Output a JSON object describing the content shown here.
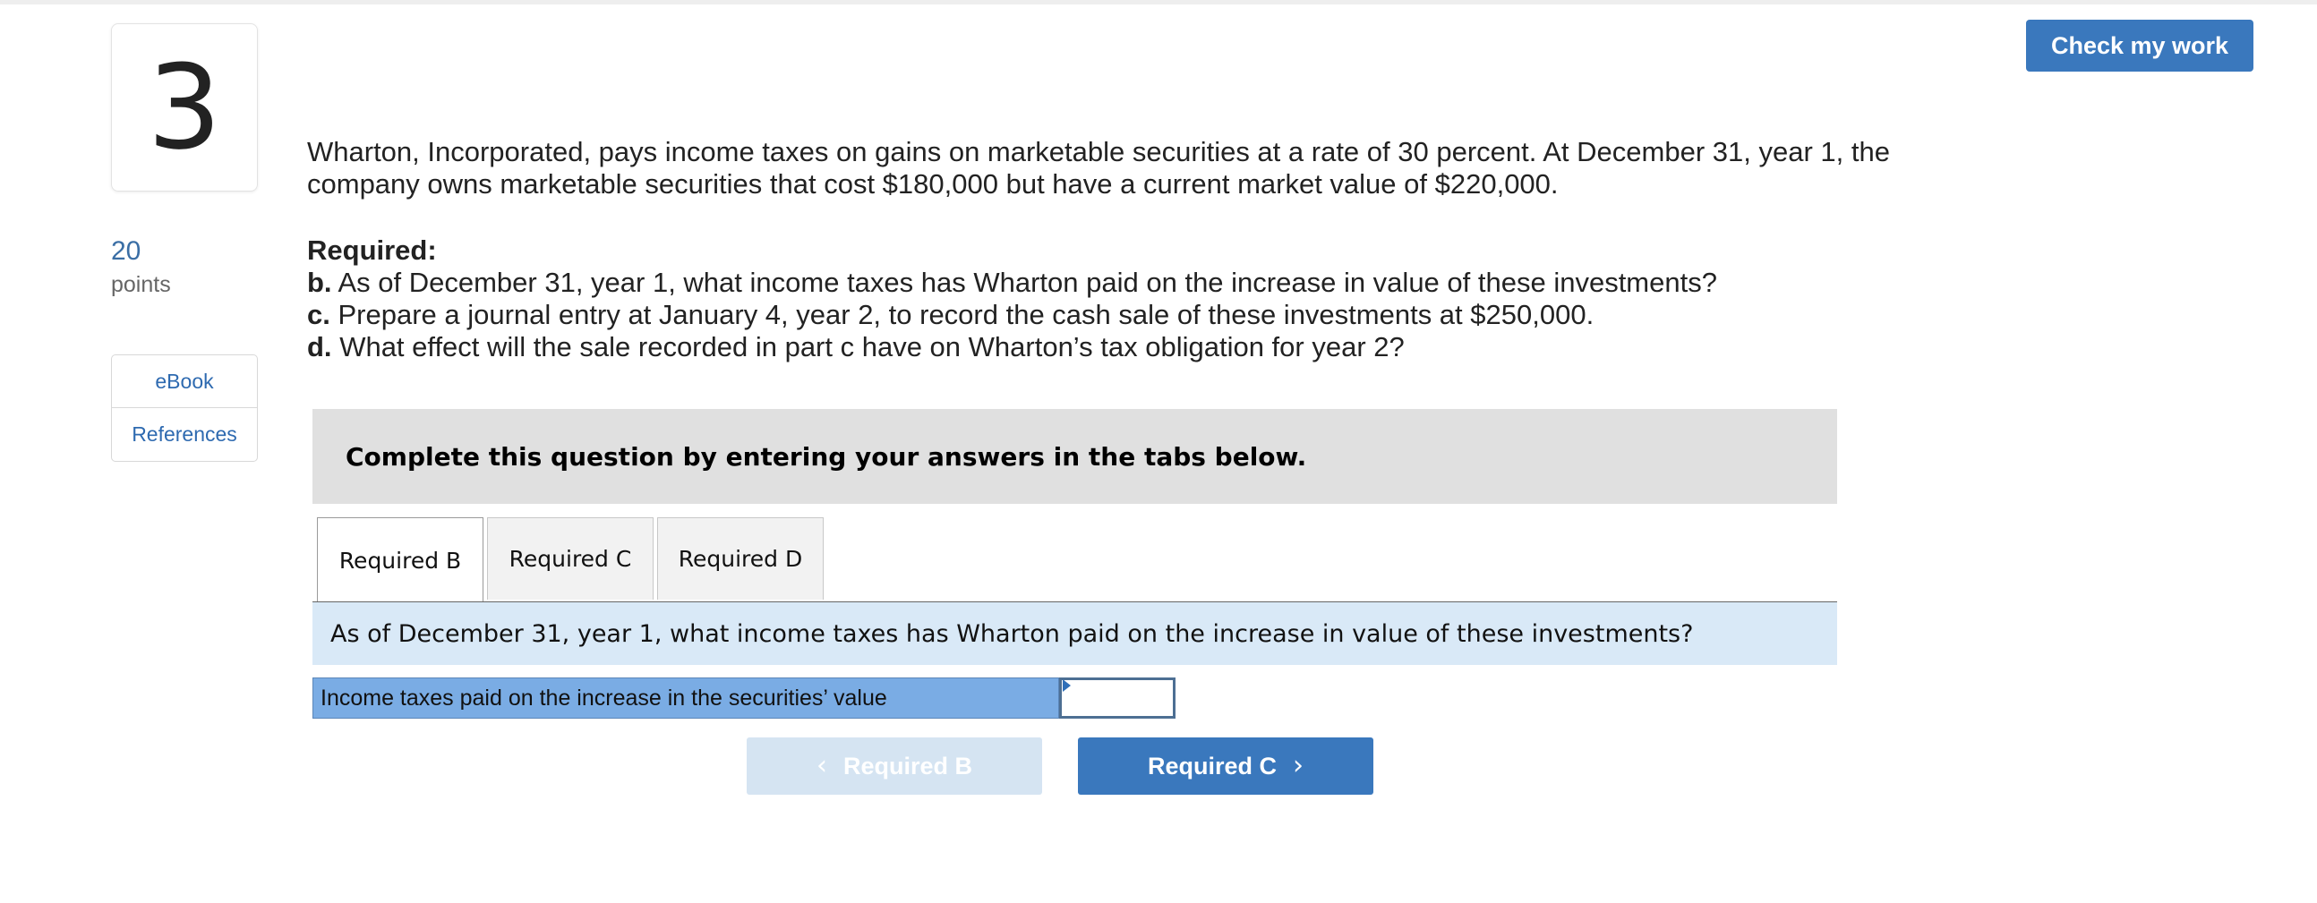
{
  "header": {
    "check_button": "Check my work"
  },
  "question": {
    "number": "3",
    "points_value": "20",
    "points_label": "points",
    "side_links": [
      "eBook",
      "References"
    ],
    "intro": "Wharton, Incorporated, pays income taxes on gains on marketable securities at a rate of 30 percent. At December 31, year 1, the company owns marketable securities that cost $180,000 but have a current market value of $220,000.",
    "required_heading": "Required:",
    "requirements": [
      {
        "letter": "b.",
        "text": "As of December 31, year 1, what income taxes has Wharton paid on the increase in value of these investments?"
      },
      {
        "letter": "c.",
        "text": "Prepare a journal entry at January 4, year 2, to record the cash sale of these investments at $250,000."
      },
      {
        "letter": "d.",
        "text": "What effect will the sale recorded in part c have on Wharton’s tax obligation for year 2?"
      }
    ]
  },
  "instructions": "Complete this question by entering your answers in the tabs below.",
  "tabs": [
    {
      "label": "Required B",
      "active": true
    },
    {
      "label": "Required C",
      "active": false
    },
    {
      "label": "Required D",
      "active": false
    }
  ],
  "active_tab": {
    "question": "As of December 31, year 1, what income taxes has Wharton paid on the increase in value of these investments?",
    "answer_label": "Income taxes paid on the increase in the securities’ value",
    "answer_value": ""
  },
  "navigation": {
    "prev_label": "Required B",
    "prev_enabled": false,
    "next_label": "Required C",
    "next_enabled": true
  },
  "colors": {
    "accent": "#3a78bd",
    "disabled_button": "#d5e4f2",
    "question_band": "#d9e9f7",
    "answer_label_bg": "#7aace4",
    "instructions_bg": "#e0e0e0"
  }
}
